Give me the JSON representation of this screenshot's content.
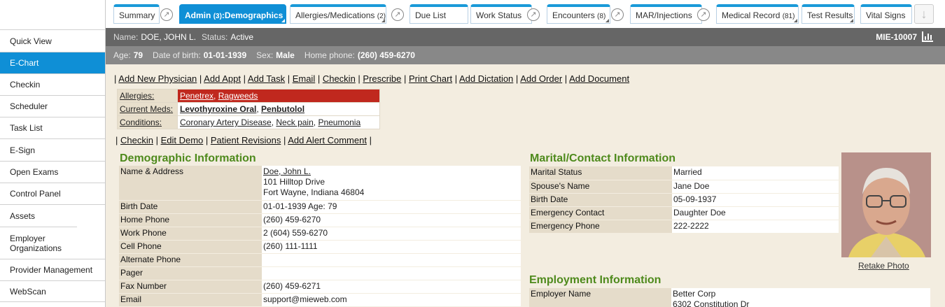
{
  "sidebar": {
    "items": [
      {
        "label": "Quick View"
      },
      {
        "label": "E-Chart"
      },
      {
        "label": "Checkin"
      },
      {
        "label": "Scheduler"
      },
      {
        "label": "Task List"
      },
      {
        "label": "E-Sign"
      },
      {
        "label": "Open Exams"
      },
      {
        "label": "Control Panel"
      },
      {
        "label": "Assets"
      },
      {
        "label": "Employer Organizations"
      },
      {
        "label": "Provider Management"
      },
      {
        "label": "WebScan"
      }
    ]
  },
  "tabs": [
    {
      "label": "Summary",
      "count": ""
    },
    {
      "label": "Admin",
      "count": "(3)",
      "suffix": ":Demographics"
    },
    {
      "label": "Allergies/Medications",
      "count": "(2)"
    },
    {
      "label": "Due List",
      "count": ""
    },
    {
      "label": "Work Status",
      "count": ""
    },
    {
      "label": "Encounters",
      "count": "(8)"
    },
    {
      "label": "MAR/Injections",
      "count": ""
    },
    {
      "label": "Medical Record",
      "count": "(81)"
    },
    {
      "label": "Test Results",
      "count": ""
    },
    {
      "label": "Vital Signs",
      "count": ""
    }
  ],
  "patient": {
    "name_label": "Name:",
    "name": "DOE, JOHN L.",
    "status_label": "Status:",
    "status": "Active",
    "mrn": "MIE-10007",
    "age_label": "Age:",
    "age": "79",
    "dob_label": "Date of birth:",
    "dob": "01-01-1939",
    "sex_label": "Sex:",
    "sex": "Male",
    "phone_label": "Home phone:",
    "phone": "(260) 459-6270"
  },
  "actions": [
    "Add New Physician",
    "Add Appt",
    "Add Task",
    "Email",
    "Checkin",
    "Prescribe",
    "Print Chart",
    "Add Dictation",
    "Add Order",
    "Add Document"
  ],
  "alerts": {
    "allergies_label": "Allergies",
    "allergies": [
      "Penetrex",
      "Ragweeds"
    ],
    "meds_label": "Current Meds",
    "meds": [
      "Levothyroxine Oral",
      "Penbutolol"
    ],
    "conditions_label": "Conditions",
    "conditions": [
      "Coronary Artery Disease",
      "Neck pain",
      "Pneumonia"
    ]
  },
  "actions2": [
    "Checkin",
    "Edit Demo",
    "Patient Revisions",
    "Add Alert Comment"
  ],
  "demographic": {
    "title": "Demographic Information",
    "rows": [
      {
        "k": "Name & Address",
        "v1": "Doe, John L.",
        "v2": "101 Hilltop Drive",
        "v3": "Fort Wayne, Indiana 46804"
      },
      {
        "k": "Birth Date",
        "v": "01-01-1939 Age: 79"
      },
      {
        "k": "Home Phone",
        "v": "(260) 459-6270"
      },
      {
        "k": "Work Phone",
        "v": "2 (604) 559-6270"
      },
      {
        "k": "Cell Phone",
        "v": "(260) 111-1111"
      },
      {
        "k": "Alternate Phone",
        "v": ""
      },
      {
        "k": "Pager",
        "v": ""
      },
      {
        "k": "Fax Number",
        "v": "(260) 459-6271"
      },
      {
        "k": "Email",
        "v": "support@mieweb.com"
      }
    ]
  },
  "marital": {
    "title": "Marital/Contact Information",
    "rows": [
      {
        "k": "Marital Status",
        "v": "Married"
      },
      {
        "k": "Spouse's Name",
        "v": "Jane Doe"
      },
      {
        "k": "Birth Date",
        "v": "05-09-1937"
      },
      {
        "k": "Emergency Contact",
        "v": "Daughter Doe"
      },
      {
        "k": "Emergency Phone",
        "v": "222-2222"
      }
    ]
  },
  "employment": {
    "title": "Employment Information",
    "rows": [
      {
        "k": "Employer Name",
        "v1": "Better Corp",
        "v2": "6302 Constitution Dr"
      }
    ]
  },
  "photo": {
    "retake": "Retake Photo"
  }
}
